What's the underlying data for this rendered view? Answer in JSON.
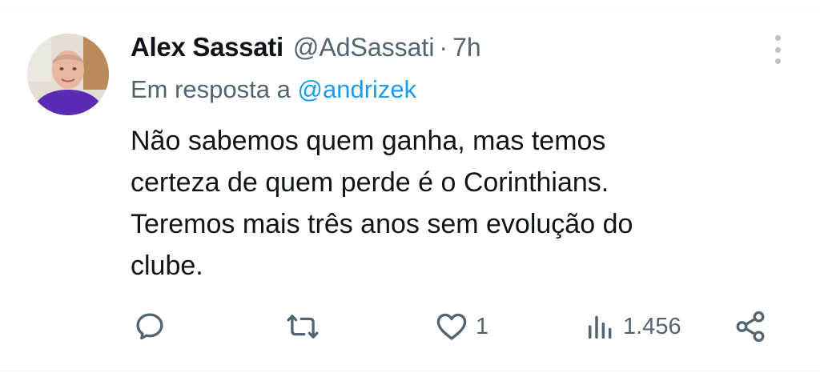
{
  "tweet": {
    "author_name": "Alex Sassati",
    "author_handle": "@AdSassati",
    "separator": "·",
    "time": "7h",
    "reply_prefix": "Em resposta a",
    "reply_to": "@andrizek",
    "text_lines": [
      "Não sabemos quem ganha, mas temos",
      "certeza de quem perde é o Corinthians.",
      "Teremos mais três anos sem evolução do",
      "clube."
    ]
  },
  "actions": {
    "reply": {
      "icon": "reply-icon"
    },
    "retweet": {
      "icon": "retweet-icon"
    },
    "like": {
      "icon": "heart-icon",
      "count": "1"
    },
    "views": {
      "icon": "views-icon",
      "count": "1.456"
    },
    "share": {
      "icon": "share-icon"
    }
  },
  "colors": {
    "text": "#0f1419",
    "secondary": "#536471",
    "link": "#1d9bf0",
    "border": "#eff3f4"
  }
}
